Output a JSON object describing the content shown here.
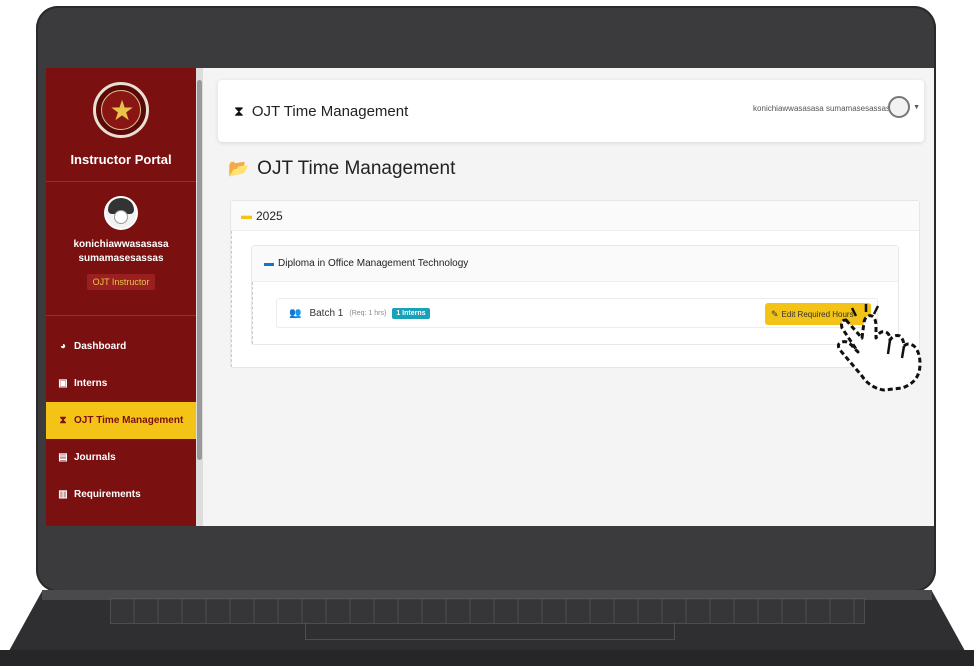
{
  "sidebar": {
    "brand_title": "Instructor Portal",
    "profile": {
      "name": "konichiawwasasasa sumamasesassas",
      "role": "OJT Instructor"
    },
    "nav": [
      {
        "label": "Dashboard",
        "icon": "dashboard-icon",
        "active": false
      },
      {
        "label": "Interns",
        "icon": "intern-icon",
        "active": false
      },
      {
        "label": "OJT Time Management",
        "icon": "hourglass-icon",
        "active": true
      },
      {
        "label": "Journals",
        "icon": "book-icon",
        "active": false
      },
      {
        "label": "Requirements",
        "icon": "file-icon",
        "active": false
      }
    ]
  },
  "topbar": {
    "title": "OJT Time Management",
    "user": "konichiawwasasasa sumamasesassas"
  },
  "main": {
    "page_title": "OJT Time Management",
    "year": "2025",
    "course": "Diploma in Office Management Technology",
    "batch": {
      "name": "Batch 1",
      "required": "(Req: 1 hrs)",
      "interns_badge": "1 Interns",
      "edit_label": "Edit Required Hours"
    }
  },
  "colors": {
    "sidebar_bg": "#7a1010",
    "accent_yellow": "#f3c318",
    "info_teal": "#17a2b8",
    "folder_blue": "#1a73c9"
  }
}
